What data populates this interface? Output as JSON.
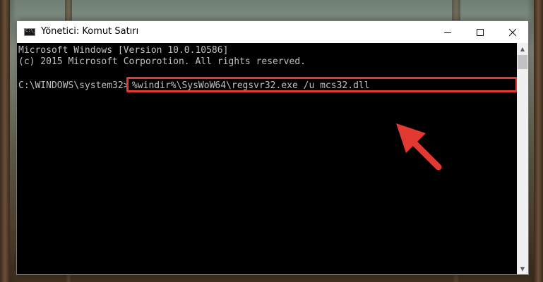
{
  "window": {
    "title": "Yönetici: Komut Satırı",
    "controls": {
      "minimize": "minimize-icon",
      "maximize": "maximize-icon",
      "close": "close-icon"
    }
  },
  "console": {
    "line1": "Microsoft Windows [Version 10.0.10586]",
    "line2": "(c) 2015 Microsoft Corporotion. All rights reserved.",
    "prompt": "C:\\WINDOWS\\system32>",
    "command": "%windir%\\SysWoW64\\regsvr32.exe /u mcs32.dll"
  },
  "annotation": {
    "highlight_color": "#e23a33",
    "arrow_color": "#e23a33"
  },
  "colors": {
    "console_bg": "#000000",
    "console_text": "#c0c0c0",
    "titlebar_bg": "#ffffff"
  }
}
